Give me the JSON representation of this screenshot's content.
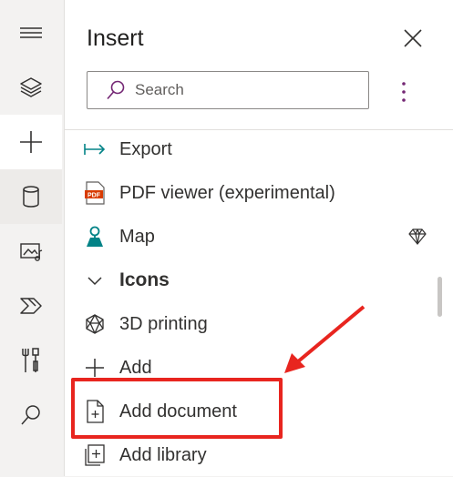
{
  "panel": {
    "title": "Insert",
    "search_placeholder": "Search"
  },
  "rail": {
    "items": [
      {
        "name": "menu-icon"
      },
      {
        "name": "layers-icon"
      },
      {
        "name": "plus-icon",
        "active": true
      },
      {
        "name": "database-icon",
        "hover": true
      },
      {
        "name": "media-icon"
      },
      {
        "name": "power-automate-icon"
      },
      {
        "name": "tools-icon"
      },
      {
        "name": "search-icon"
      }
    ]
  },
  "items": [
    {
      "label": "Export",
      "icon": "export-icon"
    },
    {
      "label": "PDF viewer (experimental)",
      "icon": "pdf-icon"
    },
    {
      "label": "Map",
      "icon": "map-icon",
      "premium": true
    },
    {
      "label": "Icons",
      "icon": "chevron-down-icon",
      "category": true
    },
    {
      "label": "3D printing",
      "icon": "3d-printing-icon"
    },
    {
      "label": "Add",
      "icon": "add-icon"
    },
    {
      "label": "Add document",
      "icon": "add-document-icon"
    },
    {
      "label": "Add library",
      "icon": "add-library-icon"
    }
  ],
  "colors": {
    "accent": "#742774",
    "highlight": "#e8251f",
    "teal": "#038387",
    "pdf": "#d83b01"
  }
}
